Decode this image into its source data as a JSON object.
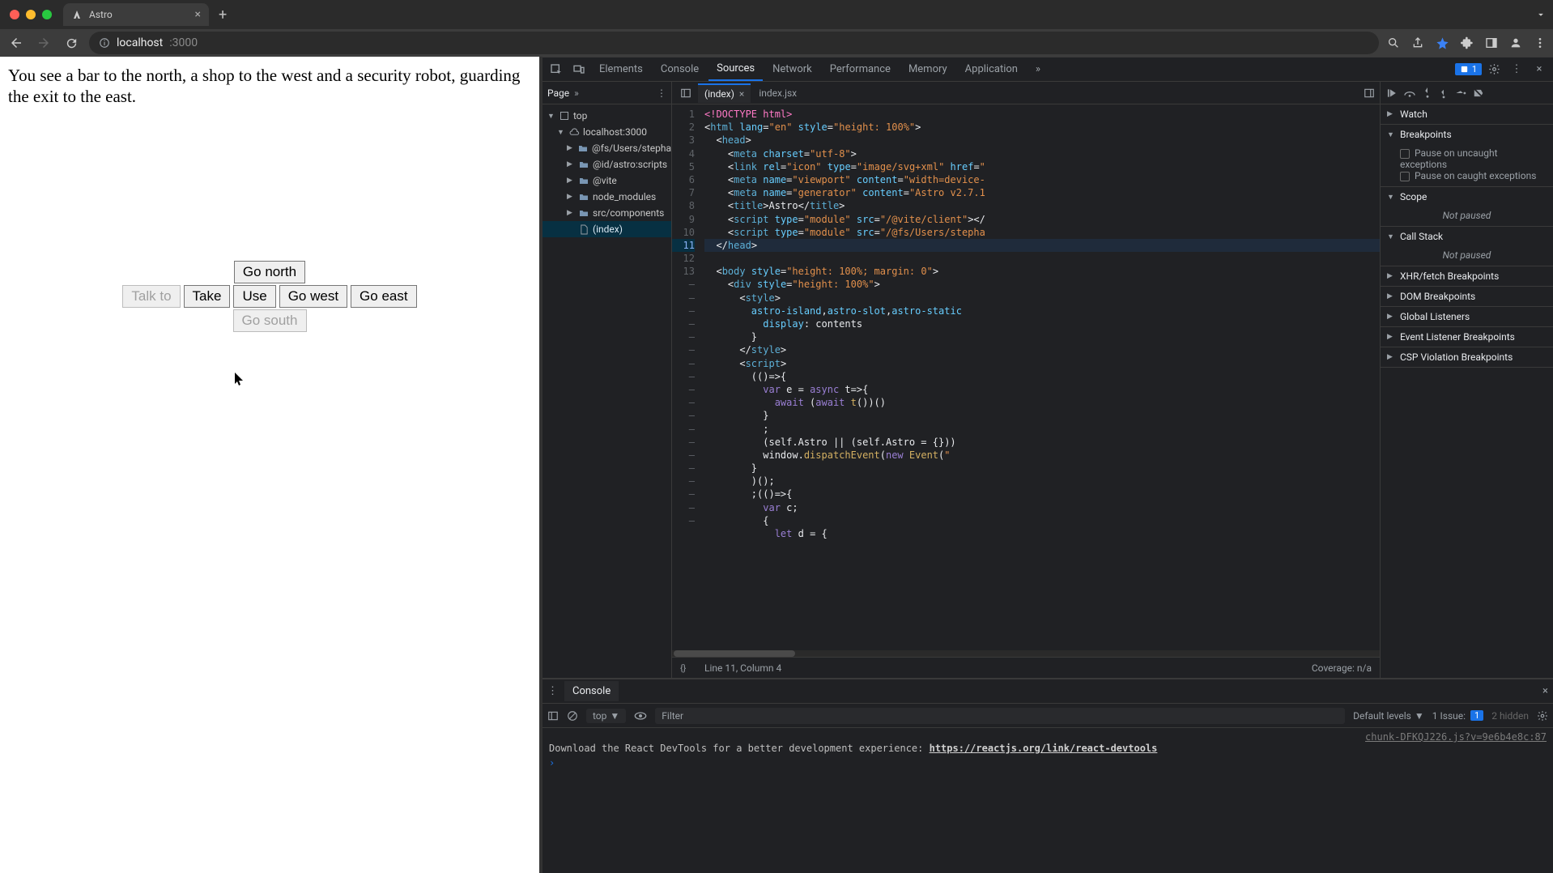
{
  "browser": {
    "tab_title": "Astro",
    "url_host": "localhost",
    "url_port": ":3000"
  },
  "page": {
    "description": "You see a bar to the north, a shop to the west and a security robot, guarding the exit to the east.",
    "buttons": {
      "north": "Go north",
      "talkto": "Talk to",
      "take": "Take",
      "use": "Use",
      "west": "Go west",
      "east": "Go east",
      "south": "Go south"
    }
  },
  "devtools": {
    "tabs": [
      "Elements",
      "Console",
      "Sources",
      "Network",
      "Performance",
      "Memory",
      "Application"
    ],
    "active_tab": "Sources",
    "issues_count": "1",
    "navigator": {
      "tab": "Page",
      "tree": {
        "top": "top",
        "origin": "localhost:3000",
        "folders": [
          "@fs/Users/stepha",
          "@id/astro:scripts",
          "@vite",
          "node_modules",
          "src/components"
        ],
        "file": "(index)"
      }
    },
    "editor": {
      "tabs": [
        {
          "name": "(index)",
          "active": true
        },
        {
          "name": "index.jsx",
          "active": false
        }
      ],
      "gutter": [
        "1",
        "2",
        "3",
        "4",
        "5",
        "6",
        "7",
        "8",
        "9",
        "10",
        "11",
        "12",
        "13",
        "–",
        "–",
        "–",
        "–",
        "–",
        "–",
        "–",
        "–",
        "–",
        "–",
        "–",
        "–",
        "–",
        "–",
        "–",
        "–",
        "–",
        "–",
        "–"
      ],
      "highlight_line_index": 10,
      "status": {
        "pos": "Line 11, Column 4",
        "coverage": "Coverage: n/a"
      }
    },
    "debugger": {
      "sections": {
        "watch": "Watch",
        "breakpoints": "Breakpoints",
        "bp_uncaught": "Pause on uncaught exceptions",
        "bp_caught": "Pause on caught exceptions",
        "scope": "Scope",
        "scope_body": "Not paused",
        "callstack": "Call Stack",
        "callstack_body": "Not paused",
        "xhr": "XHR/fetch Breakpoints",
        "dom": "DOM Breakpoints",
        "global": "Global Listeners",
        "event": "Event Listener Breakpoints",
        "csp": "CSP Violation Breakpoints"
      }
    },
    "console": {
      "title": "Console",
      "context": "top",
      "filter_placeholder": "Filter",
      "levels": "Default levels",
      "issue_label": "1 Issue:",
      "issue_count": "1",
      "hidden": "2 hidden",
      "src_link": "chunk-DFKQJ226.js?v=9e6b4e8c:87",
      "msg_prefix": "Download the React DevTools for a better development experience: ",
      "msg_link": "https://reactjs.org/link/react-devtools"
    }
  }
}
